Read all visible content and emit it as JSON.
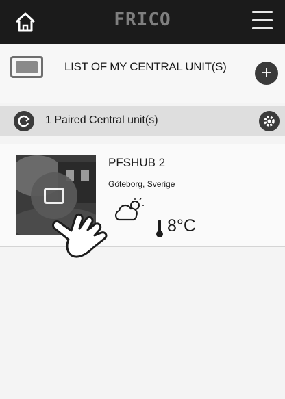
{
  "header": {
    "logo_text": "FRICO",
    "home_icon": "home-icon",
    "menu_icon": "hamburger-menu-icon"
  },
  "list_header": {
    "title": "LIST OF MY CENTRAL UNIT(S)",
    "add_label": "+"
  },
  "paired_bar": {
    "text": "1 Paired Central unit(s)"
  },
  "unit": {
    "name": "PFSHUB 2",
    "location": "Göteborg, Sverige",
    "weather_icon": "partly-cloudy-icon",
    "temperature": "8°C"
  },
  "colors": {
    "topbar": "#1b1b1b",
    "paired_bar": "#dedede",
    "icon_dark": "#3b3b3b"
  }
}
